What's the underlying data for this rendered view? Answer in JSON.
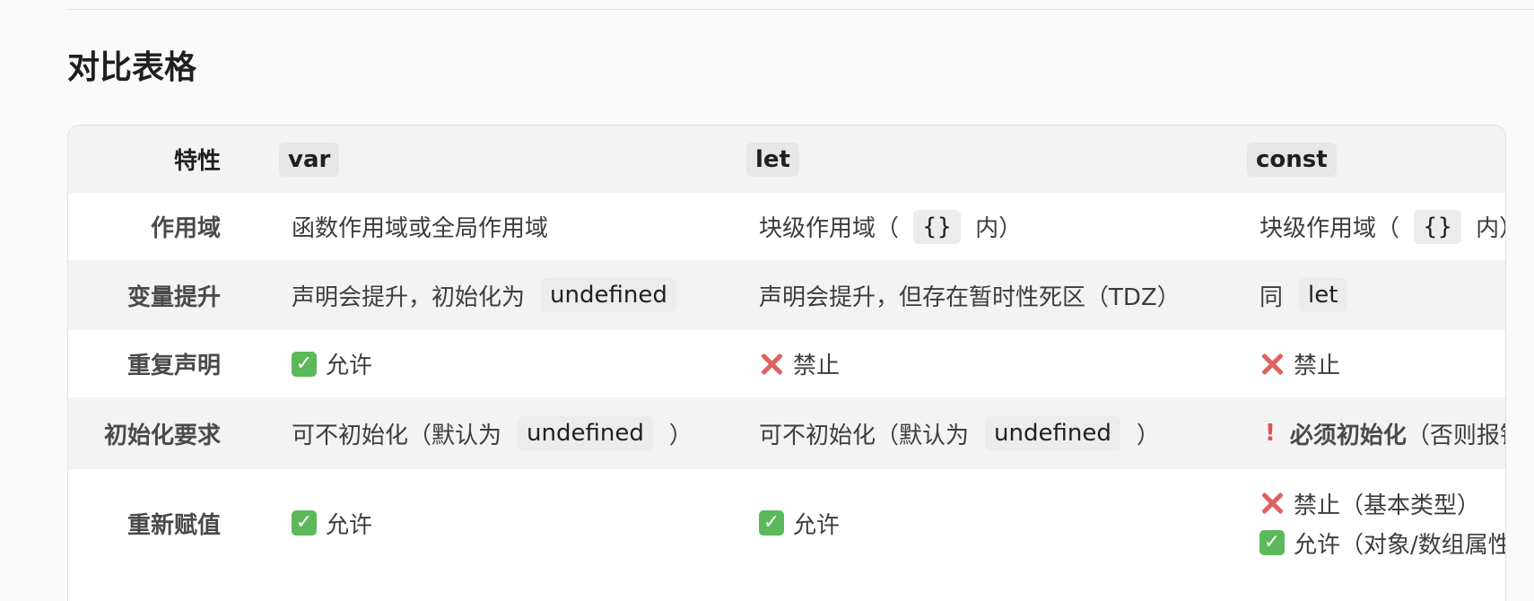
{
  "section": {
    "title": "对比表格"
  },
  "table": {
    "header": {
      "feature": "特性",
      "var": "var",
      "let": "let",
      "const": "const"
    },
    "rows": [
      {
        "feature": "作用域",
        "var": "函数作用域或全局作用域",
        "let": {
          "before": "块级作用域（",
          "code": "{}",
          "after": "内）"
        },
        "const": {
          "before": "块级作用域（",
          "code": "{}",
          "after": "内）"
        }
      },
      {
        "feature": "变量提升",
        "var": {
          "before": "声明会提升，初始化为",
          "code": "undefined"
        },
        "let": "声明会提升，但存在暂时性死区（TDZ）",
        "const": {
          "before": "同",
          "code": "let"
        }
      },
      {
        "feature": "重复声明",
        "var": {
          "icon": "check-icon",
          "text": "允许"
        },
        "let": {
          "icon": "cross-icon",
          "text": "禁止"
        },
        "const": {
          "icon": "cross-icon",
          "text": "禁止"
        }
      },
      {
        "feature": "初始化要求",
        "var": {
          "before": "可不初始化（默认为",
          "code": "undefined",
          "after": "）"
        },
        "let": {
          "before": "可不初始化（默认为",
          "code": "undefined",
          "after": "）"
        },
        "const": {
          "icon": "exclamation-icon",
          "strong": "必须初始化",
          "after": "（否则报错）"
        }
      },
      {
        "feature": "重新赋值",
        "var": {
          "icon": "check-icon",
          "text": "允许"
        },
        "let": {
          "icon": "check-icon",
          "text": "允许"
        },
        "const": {
          "line1": {
            "icon": "cross-icon",
            "text": "禁止（基本类型）"
          },
          "line2": {
            "icon": "check-icon",
            "text": "允许（对象/数组属性修改）"
          }
        }
      }
    ]
  },
  "colors": {
    "check": "#5bb85b",
    "cross": "#e0625f",
    "exclamation": "#e0514f",
    "row_shade": "#f3f3f3"
  }
}
